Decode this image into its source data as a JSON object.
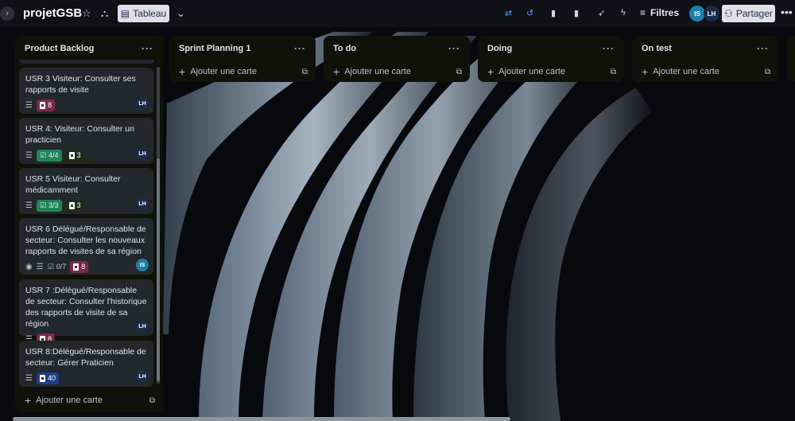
{
  "header": {
    "board_title": "projetGSB",
    "view_label": "Tableau",
    "filters_label": "Filtres",
    "share_label": "Partager",
    "avatars": [
      "IS",
      "LH"
    ]
  },
  "icons": {
    "collapse": "chevron-right-icon",
    "star": "star-icon",
    "workspace": "workspace-icon",
    "view": "board-icon",
    "view_dropdown": "chevron-down-icon",
    "filters": "filter-icon",
    "share": "person-add-icon",
    "more": "ellipsis-icon"
  },
  "colors": {
    "list_bg": "#0f1209",
    "card_bg": "#22272b",
    "check_complete": "#1f845a",
    "points_pink": "#7a2a48",
    "points_blue": "#1d3e8a"
  },
  "lists": [
    {
      "title": "Product Backlog",
      "add_label": "Ajouter une carte",
      "cards": [
        {
          "title": "USR 3 Visiteur: Consulter ses rapports de visite",
          "points": "8",
          "checklist": "",
          "member": "LH"
        },
        {
          "title": "USR 4: Visiteur: Consulter un practicien",
          "points": "3",
          "checklist": "4/4",
          "member": "LH"
        },
        {
          "title": "USR 5 Visiteur: Consulter médicamment",
          "points": "3",
          "checklist": "3/3",
          "member": "LH"
        },
        {
          "title": "USR 6 Délégué/Responsable de secteur: Consulter les nouveaux rapports de visites de sa région",
          "points": "8",
          "checklist": "0/7",
          "member": "IS"
        },
        {
          "title": "USR 7 :Délégué/Responsable de secteur: Consulter l'historique des rapports de visite de sa région",
          "points": "8",
          "checklist": "",
          "member": "LH"
        },
        {
          "title": "USR 8:Délégué/Responsable de secteur: Gérer Praticien",
          "points": "40",
          "checklist": "",
          "member": "LH"
        }
      ]
    },
    {
      "title": "Sprint Planning 1",
      "add_label": "Ajouter une carte"
    },
    {
      "title": "To do",
      "add_label": "Ajouter une carte"
    },
    {
      "title": "Doing",
      "add_label": "Ajouter une carte"
    },
    {
      "title": "On test",
      "add_label": "Ajouter une carte"
    }
  ]
}
